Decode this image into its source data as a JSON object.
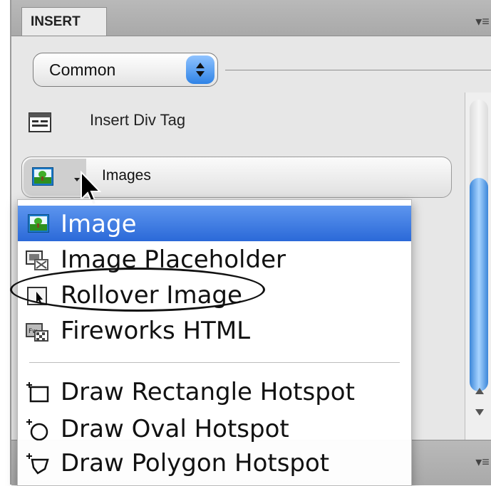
{
  "panel": {
    "tab_label": "INSERT",
    "category_select": {
      "value": "Common"
    },
    "insert_div_tag_label": "Insert Div Tag",
    "images_button_label": "Images"
  },
  "menu": {
    "items": [
      {
        "label": "Image",
        "icon": "image-icon",
        "selected": true
      },
      {
        "label": "Image Placeholder",
        "icon": "image-placeholder-icon",
        "selected": false
      },
      {
        "label": "Rollover Image",
        "icon": "rollover-image-icon",
        "selected": false
      },
      {
        "label": "Fireworks HTML",
        "icon": "fireworks-html-icon",
        "selected": false
      },
      {
        "label": "Draw Rectangle Hotspot",
        "icon": "rectangle-hotspot-icon",
        "selected": false
      },
      {
        "label": "Draw Oval Hotspot",
        "icon": "oval-hotspot-icon",
        "selected": false
      },
      {
        "label": "Draw Polygon Hotspot",
        "icon": "polygon-hotspot-icon",
        "selected": false
      }
    ]
  },
  "colors": {
    "selection": "#2b69d8",
    "accent": "#2f83e6",
    "panel_bg": "#e7e7e7"
  }
}
